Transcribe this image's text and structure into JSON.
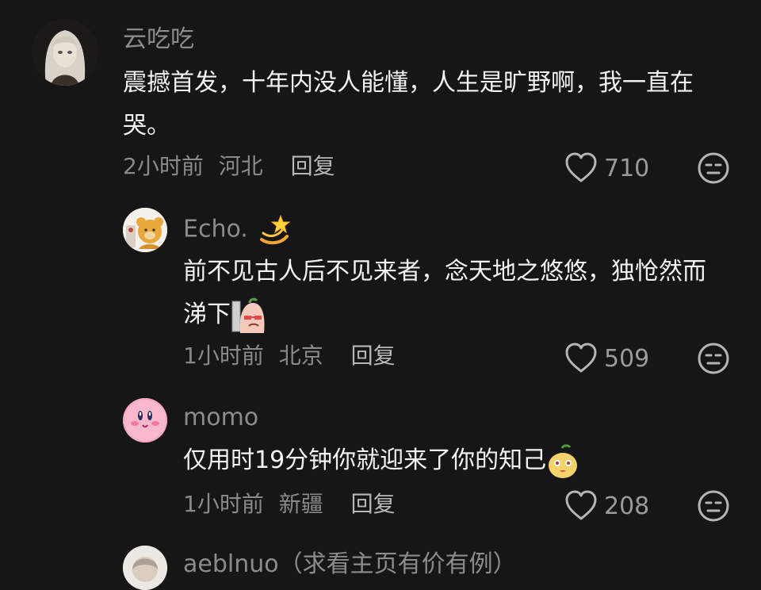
{
  "comments": [
    {
      "username": "云吃吃",
      "text": "震撼首发，十年内没人能懂，人生是旷野啊，我一直在哭。",
      "time": "2小时前",
      "location": "河北",
      "reply_label": "回复",
      "likes": "710",
      "avatar_icon": "silver-haired-doll-avatar"
    },
    {
      "username": "Echo.",
      "username_emoji_icon": "dizzy-star-icon",
      "text": "前不见古人后不见来者，念天地之悠悠，独怆然而涕下",
      "text_emoji_icon": "crying-peach-emoji-icon",
      "time": "1小时前",
      "location": "北京",
      "reply_label": "回复",
      "likes": "509",
      "avatar_icon": "bear-plush-avatar"
    },
    {
      "username": "momo",
      "text": "仅用时19分钟你就迎来了你的知己",
      "text_emoji_icon": "pear-face-emoji-icon",
      "time": "1小时前",
      "location": "新疆",
      "reply_label": "回复",
      "likes": "208",
      "avatar_icon": "kirby-avatar"
    },
    {
      "username": "aeblnuo（求看主页有价有例）",
      "avatar_icon": "illustrated-girl-avatar"
    }
  ]
}
